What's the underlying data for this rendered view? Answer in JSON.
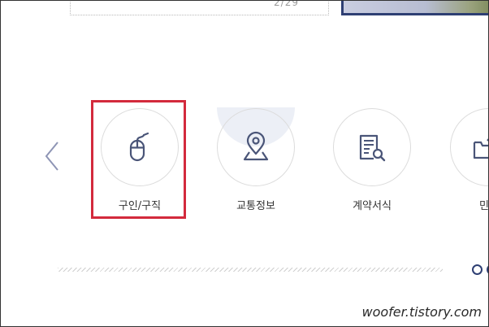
{
  "notice": {
    "page_indicator": "2/29"
  },
  "carousel": {
    "items": [
      {
        "label": "구인/구직",
        "icon": "mouse-icon"
      },
      {
        "label": "교통정보",
        "icon": "map-pin-icon"
      },
      {
        "label": "계약서식",
        "icon": "document-search-icon"
      },
      {
        "label": "민원",
        "icon": "folder-upload-icon"
      }
    ],
    "selected_label": "구인/구직"
  },
  "colors": {
    "accent_navy": "#2e3f73",
    "highlight_red": "#d32a3c",
    "icon_color": "#4a5578"
  },
  "watermark": {
    "text": "woofer.tistory.com"
  }
}
